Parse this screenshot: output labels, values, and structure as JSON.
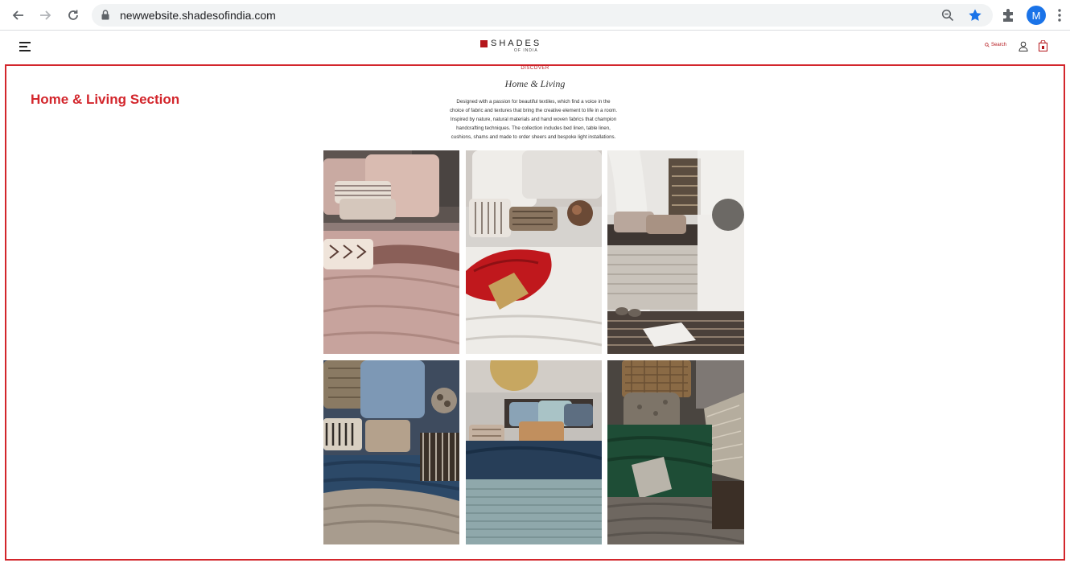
{
  "browser": {
    "url": "newwebsite.shadesofindia.com",
    "profile_initial": "M",
    "accent": "#1a73e8"
  },
  "site": {
    "logo_text": "SHADES",
    "logo_sub": "OF INDIA",
    "search_label": "Search",
    "brand_color": "#b4161b"
  },
  "annotation": {
    "label": "Home & Living Section",
    "color": "#d3262c"
  },
  "section": {
    "eyebrow": "DISCOVER",
    "title": "Home & Living",
    "description": "Designed with a passion for beautiful textiles, which find a voice in the choice of fabric and textures that bring the creative element to life in a room. Inspired by nature, natural materials and hand woven fabrics that champion handcrafting techniques. The collection includes bed linen, table linen, cushions, shams and made to order sheers and bespoke light installations."
  },
  "gallery": [
    {
      "name": "blush-bedding"
    },
    {
      "name": "white-red-bedding"
    },
    {
      "name": "sheer-window-bedroom"
    },
    {
      "name": "blue-layered-bedding"
    },
    {
      "name": "seafoam-bedding"
    },
    {
      "name": "green-textured-bedding"
    }
  ]
}
